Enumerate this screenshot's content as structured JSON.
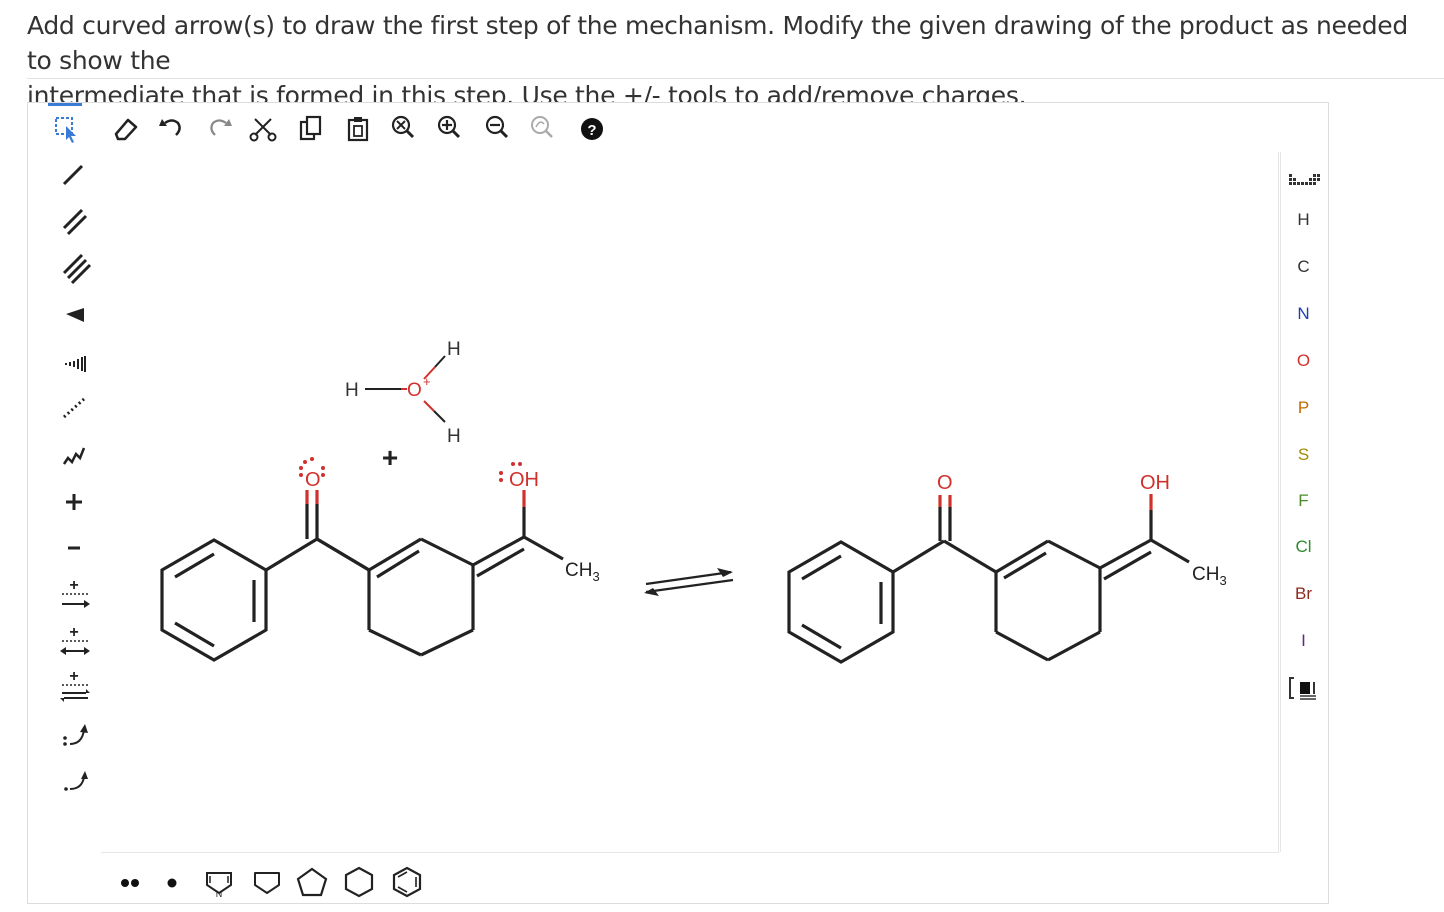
{
  "prompt": {
    "line1": "Add curved arrow(s) to draw the first step of the mechanism. Modify the given drawing of the product as needed to show the",
    "line2": "intermediate that is formed in this step. Use the +/- tools to add/remove charges."
  },
  "toolbar": {
    "icons": [
      "select-icon",
      "eraser-icon",
      "undo-icon",
      "redo-icon",
      "cut-icon",
      "copy-icon",
      "paste-icon",
      "zoom-reset-icon",
      "zoom-in-icon",
      "zoom-out-icon",
      "clean-structure-icon",
      "help-icon"
    ]
  },
  "left_tools": {
    "icons": [
      "single-bond-icon",
      "double-bond-icon",
      "triple-bond-icon",
      "wedge-bond-icon",
      "hashed-wedge-icon",
      "dashed-bond-icon",
      "wavy-bond-icon",
      "positive-charge-icon",
      "negative-charge-icon",
      "reaction-arrow-icon",
      "resonance-arrow-icon",
      "equilibrium-arrow-icon",
      "electron-pair-arrow-icon",
      "single-electron-arrow-icon"
    ],
    "plus": "+",
    "minus": "–"
  },
  "elements": [
    "H",
    "C",
    "N",
    "O",
    "P",
    "S",
    "F",
    "Cl",
    "Br",
    "I"
  ],
  "element_colors": {
    "H": "#333333",
    "C": "#333333",
    "N": "#1f3fae",
    "O": "#d0312d",
    "P": "#c46a00",
    "S": "#a68a00",
    "F": "#4d8b2a",
    "Cl": "#2e8b2e",
    "Br": "#8b2a1f",
    "I": "#5b2a8b"
  },
  "bottom_tools": [
    "lone-pair-icon",
    "radical-icon",
    "pyrrole-template-icon",
    "cyclobutane-template-icon",
    "cyclopentane-template-icon",
    "cyclohexane-template-icon",
    "benzene-template-icon"
  ],
  "molecules": {
    "hydronium": {
      "h_left": "H",
      "o": "O",
      "charge": "+",
      "h_top": "H",
      "h_bottom": "H"
    },
    "plus_sign": "+",
    "reactant": {
      "ketone_o": "O",
      "enol_oh": "OH",
      "methyl": "CH",
      "methyl_sub": "3"
    },
    "product": {
      "ketone_o": "O",
      "enol_oh": "OH",
      "methyl": "CH",
      "methyl_sub": "3"
    }
  }
}
